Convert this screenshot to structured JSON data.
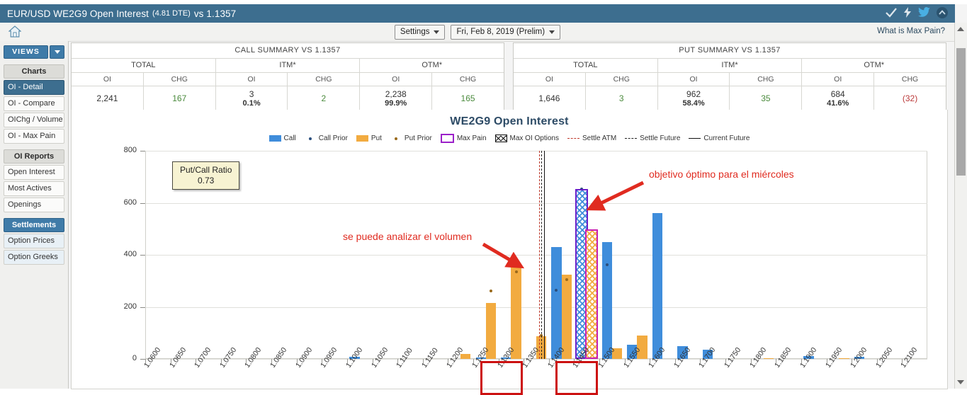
{
  "titlebar": {
    "main": "EUR/USD WE2G9 Open Interest",
    "dte": "(4.81 DTE)",
    "vs": "vs  1.1357",
    "icons": [
      "check-icon",
      "lightning-icon",
      "twitter-icon",
      "collapse-icon"
    ]
  },
  "toolbar": {
    "home_icon": "home-icon",
    "settings_label": "Settings",
    "date_label": "Fri, Feb 8, 2019 (Prelim)",
    "maxpain_link": "What is Max Pain?"
  },
  "sidebar": {
    "views_label": "VIEWS",
    "groups": [
      {
        "header": "Charts",
        "style": "grey",
        "items": [
          {
            "label": "OI - Detail",
            "state": "active"
          },
          {
            "label": "OI - Compare",
            "state": "normal"
          },
          {
            "label": "OIChg / Volume",
            "state": "normal"
          },
          {
            "label": "OI - Max Pain",
            "state": "normal"
          }
        ]
      },
      {
        "header": "OI Reports",
        "style": "grey",
        "items": [
          {
            "label": "Open Interest",
            "state": "normal"
          },
          {
            "label": "Most Actives",
            "state": "normal"
          },
          {
            "label": "Openings",
            "state": "normal"
          }
        ]
      },
      {
        "header": "Settlements",
        "style": "blue",
        "items": [
          {
            "label": "Option Prices",
            "state": "light"
          },
          {
            "label": "Option Greeks",
            "state": "light"
          }
        ]
      }
    ]
  },
  "summary": {
    "call": {
      "caption": "CALL SUMMARY VS 1.1357",
      "groups": [
        "TOTAL",
        "ITM*",
        "OTM*"
      ],
      "subheaders": [
        "OI",
        "CHG",
        "OI",
        "CHG",
        "OI",
        "CHG"
      ],
      "values": [
        {
          "main": "2,241",
          "pct": "",
          "color": "plain"
        },
        {
          "main": "167",
          "pct": "",
          "color": "pos"
        },
        {
          "main": "3",
          "pct": "0.1%",
          "color": "plain"
        },
        {
          "main": "2",
          "pct": "",
          "color": "pos"
        },
        {
          "main": "2,238",
          "pct": "99.9%",
          "color": "plain"
        },
        {
          "main": "165",
          "pct": "",
          "color": "pos"
        }
      ]
    },
    "put": {
      "caption": "PUT SUMMARY VS 1.1357",
      "groups": [
        "TOTAL",
        "ITM*",
        "OTM*"
      ],
      "subheaders": [
        "OI",
        "CHG",
        "OI",
        "CHG",
        "OI",
        "CHG"
      ],
      "values": [
        {
          "main": "1,646",
          "pct": "",
          "color": "plain"
        },
        {
          "main": "3",
          "pct": "",
          "color": "pos"
        },
        {
          "main": "962",
          "pct": "58.4%",
          "color": "plain"
        },
        {
          "main": "35",
          "pct": "",
          "color": "pos"
        },
        {
          "main": "684",
          "pct": "41.6%",
          "color": "plain"
        },
        {
          "main": "(32)",
          "pct": "",
          "color": "neg"
        }
      ]
    }
  },
  "chart_data": {
    "type": "bar",
    "title": "WE2G9 Open Interest",
    "xlabel": "",
    "ylabel": "",
    "ylim": [
      0,
      800
    ],
    "yticks": [
      0,
      200,
      400,
      600,
      800
    ],
    "grid": true,
    "legend_position": "top",
    "legend": [
      {
        "label": "Call",
        "marker": "square",
        "color": "#3f8ddb"
      },
      {
        "label": "Call Prior",
        "marker": "dot",
        "color": "#2b4f7e"
      },
      {
        "label": "Put",
        "marker": "square",
        "color": "#f2ab40"
      },
      {
        "label": "Put Prior",
        "marker": "dot",
        "color": "#9a6a1c"
      },
      {
        "label": "Max Pain",
        "marker": "outline-box",
        "color": "#9b20c9"
      },
      {
        "label": "Max OI Options",
        "marker": "hatched-box",
        "color": "#111111"
      },
      {
        "label": "Settle ATM",
        "marker": "dashed-line",
        "color": "#c0392b"
      },
      {
        "label": "Settle Future",
        "marker": "dashed-line",
        "color": "#222222"
      },
      {
        "label": "Current Future",
        "marker": "solid-line",
        "color": "#111111"
      }
    ],
    "categories": [
      "1.0600",
      "1.0650",
      "1.0700",
      "1.0750",
      "1.0800",
      "1.0850",
      "1.0900",
      "1.0950",
      "1.1000",
      "1.1050",
      "1.1100",
      "1.1150",
      "1.1200",
      "1.1250",
      "1.1300",
      "1.1350",
      "1.1400",
      "1.1450",
      "1.1500",
      "1.1550",
      "1.1600",
      "1.1650",
      "1.1700",
      "1.1750",
      "1.1800",
      "1.1850",
      "1.1900",
      "1.1950",
      "1.2000",
      "1.2050",
      "1.2100"
    ],
    "series": [
      {
        "name": "Call",
        "color": "#3f8ddb",
        "values": [
          0,
          0,
          0,
          0,
          0,
          0,
          0,
          0,
          7,
          0,
          0,
          0,
          0,
          5,
          6,
          0,
          430,
          645,
          450,
          55,
          560,
          50,
          35,
          0,
          0,
          0,
          12,
          0,
          8,
          0,
          0
        ]
      },
      {
        "name": "Put",
        "color": "#f2ab40",
        "values": [
          0,
          0,
          0,
          0,
          0,
          0,
          0,
          0,
          0,
          0,
          0,
          0,
          20,
          215,
          357,
          88,
          325,
          490,
          42,
          90,
          0,
          0,
          0,
          0,
          4,
          0,
          0,
          3,
          0,
          0,
          0
        ]
      },
      {
        "name": "Call Prior",
        "color": "#2b4f7e",
        "marker": "dot",
        "values": [
          null,
          null,
          null,
          null,
          null,
          null,
          null,
          null,
          null,
          null,
          null,
          null,
          null,
          null,
          null,
          null,
          264,
          652,
          362,
          null,
          null,
          null,
          null,
          null,
          null,
          null,
          null,
          null,
          null,
          null,
          null
        ]
      },
      {
        "name": "Put Prior",
        "color": "#9a6a1c",
        "marker": "dot",
        "values": [
          null,
          null,
          null,
          null,
          null,
          null,
          null,
          null,
          null,
          null,
          null,
          null,
          null,
          260,
          334,
          90,
          304,
          null,
          null,
          null,
          null,
          null,
          null,
          null,
          null,
          null,
          null,
          null,
          null,
          null,
          null
        ]
      }
    ],
    "markers": {
      "max_pain_strike": "1.1450",
      "max_oi_call_strike": "1.1450",
      "max_oi_put_strike": "1.1450",
      "settle_atm": "1.1357",
      "settle_future": "1.1357",
      "current_future": "1.1357"
    },
    "put_call_ratio_box": {
      "label": "Put/Call Ratio",
      "value": "0.73"
    },
    "annotations": [
      {
        "text": "se puede analizar el volumen",
        "color": "#e02b20",
        "points_to": "1.1300"
      },
      {
        "text": "objetivo óptimo para el miércoles",
        "color": "#e02b20",
        "points_to": "1.1450"
      }
    ],
    "highlight_boxes": [
      {
        "label": "1.1300",
        "color": "#cc1111"
      },
      {
        "label": "1.1450",
        "color": "#cc1111"
      }
    ]
  }
}
